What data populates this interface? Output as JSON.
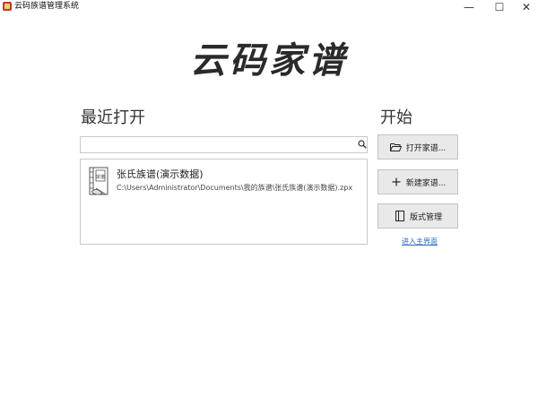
{
  "window": {
    "title": "云码族谱管理系统",
    "minimize_glyph": "—",
    "maximize_glyph": "☐",
    "close_glyph": "✕"
  },
  "logo": {
    "text": "云码家谱"
  },
  "recent": {
    "title": "最近打开",
    "search": {
      "value": "",
      "placeholder": ""
    },
    "items": [
      {
        "name": "张氏族谱(演示数据)",
        "path": "C:\\Users\\Administrator\\Documents\\我的族谱\\张氏族谱(演示数据).zpx",
        "icon": "family-book-icon",
        "icon_label": "宗谱"
      }
    ]
  },
  "start": {
    "title": "开始",
    "open_label": "打开家谱...",
    "new_label": "新建家谱...",
    "style_label": "版式管理",
    "enter_link": "进入主界面"
  },
  "colors": {
    "accent_link": "#2b6cc4",
    "button_bg": "#e9e9e9",
    "border": "#c9c9c9"
  }
}
